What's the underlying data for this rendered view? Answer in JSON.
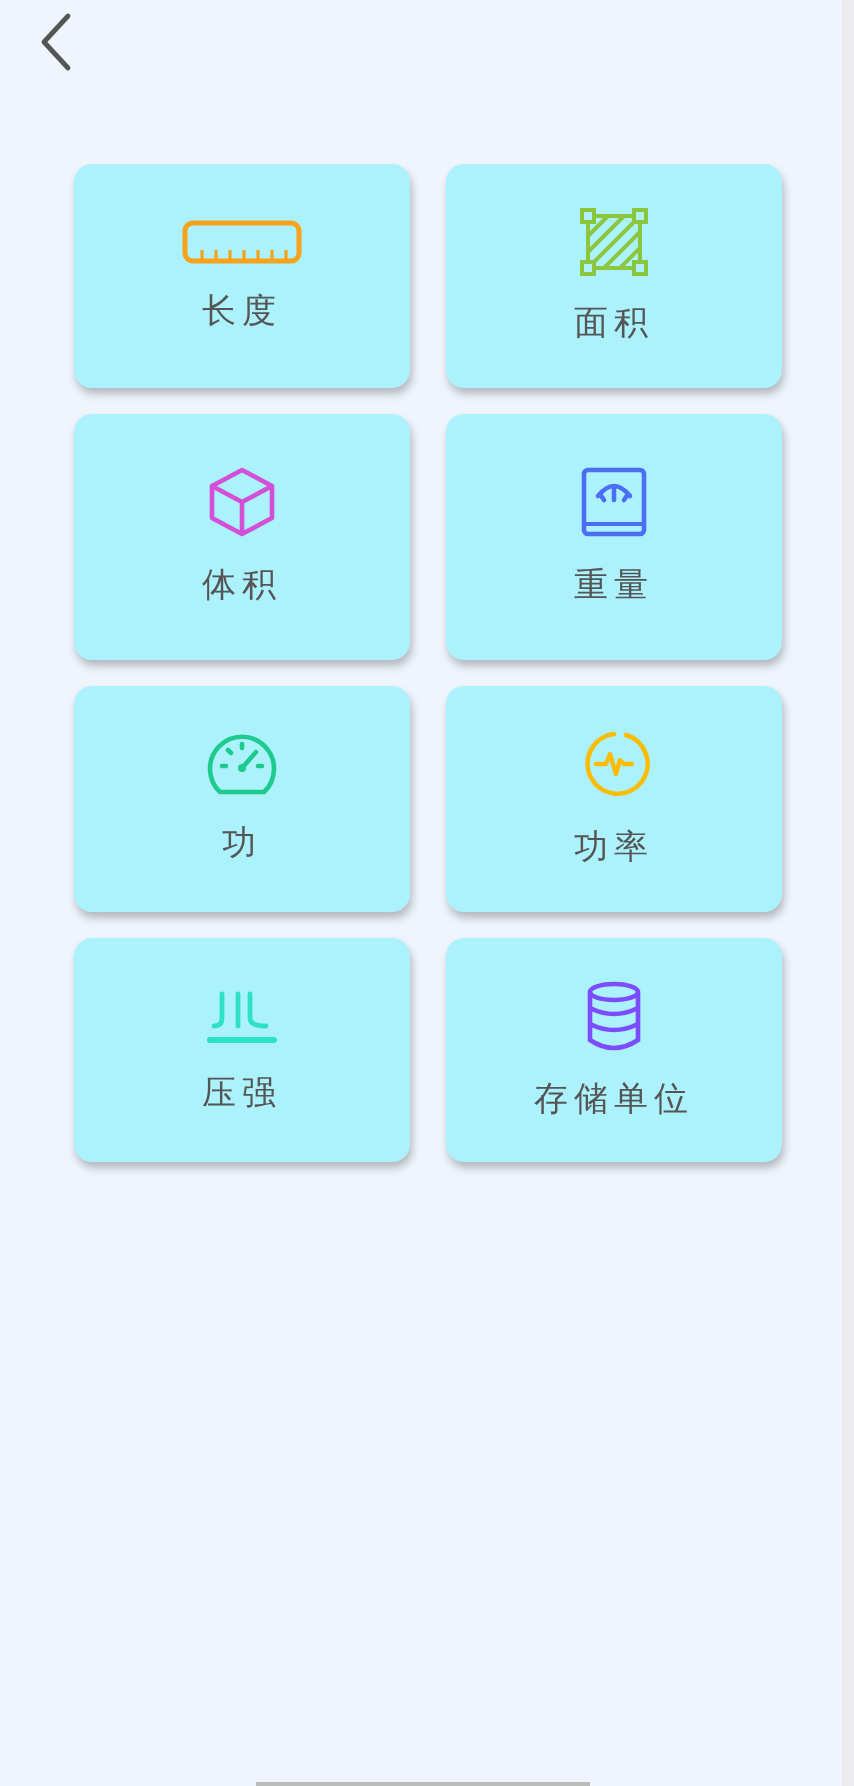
{
  "units": [
    {
      "label": "长度",
      "kind": "ruler"
    },
    {
      "label": "面积",
      "kind": "area"
    },
    {
      "label": "体积",
      "kind": "cube"
    },
    {
      "label": "重量",
      "kind": "scale"
    },
    {
      "label": "功",
      "kind": "gauge"
    },
    {
      "label": "功率",
      "kind": "pulse"
    },
    {
      "label": "压强",
      "kind": "pressure"
    },
    {
      "label": "存储单位",
      "kind": "database"
    }
  ]
}
